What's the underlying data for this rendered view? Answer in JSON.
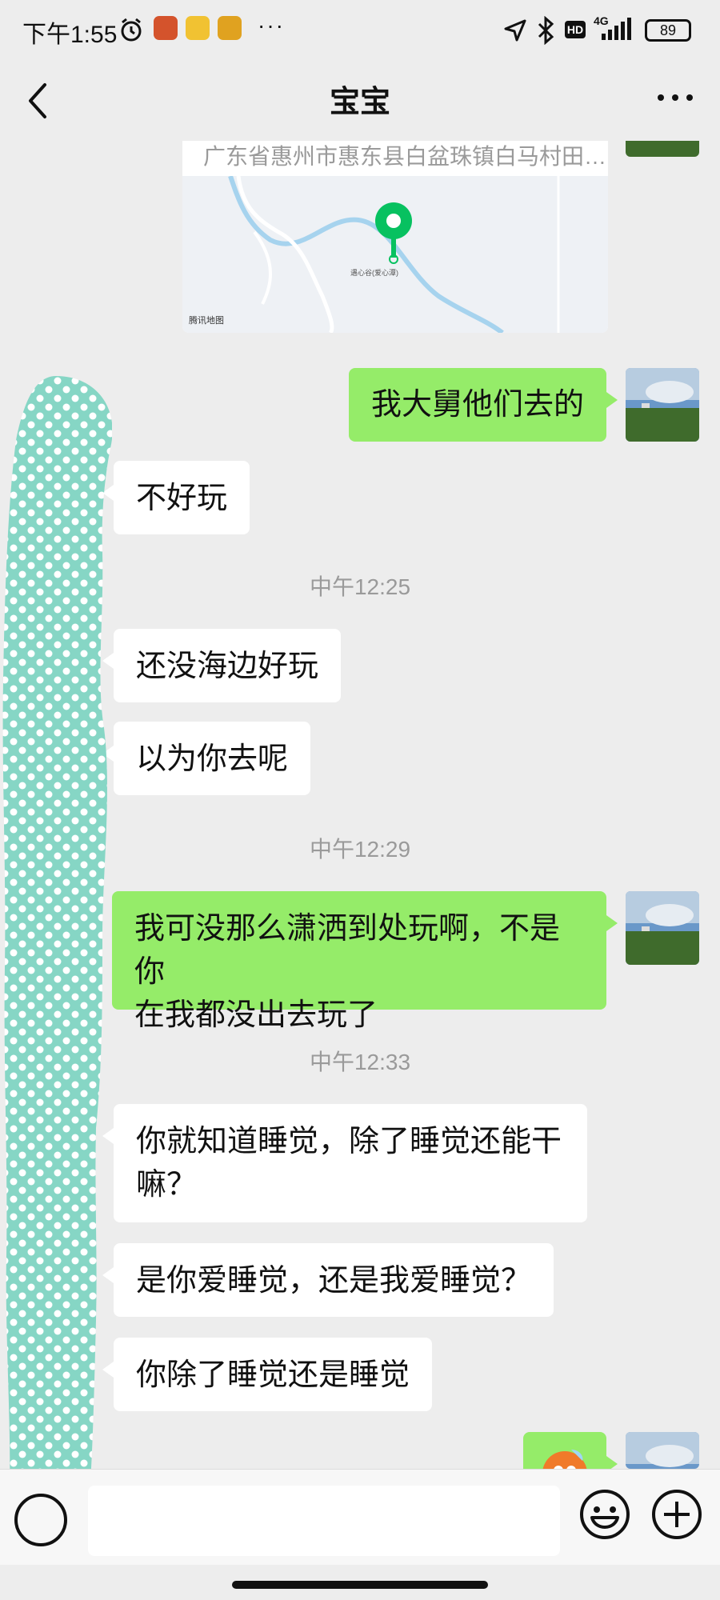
{
  "status_bar": {
    "time": "下午1:55",
    "network": "4G",
    "hd": "HD",
    "battery": "89"
  },
  "nav": {
    "title": "宝宝"
  },
  "location": {
    "address": "广东省惠州市惠东县白盆珠镇白马村田…",
    "pin_label": "遇心谷(爱心潭)",
    "map_brand": "腾讯地图"
  },
  "messages": [
    {
      "side": "right",
      "text": "我大舅他们去的"
    },
    {
      "side": "left",
      "text": "不好玩"
    },
    {
      "type": "time",
      "text": "中午12:25"
    },
    {
      "side": "left",
      "text": "还没海边好玩"
    },
    {
      "side": "left",
      "text": "以为你去呢"
    },
    {
      "type": "time",
      "text": "中午12:29"
    },
    {
      "side": "right",
      "text_line1": "我可没那么潇洒到处玩啊，不是你",
      "text_line2": "在我都没出去玩了"
    },
    {
      "type": "time",
      "text": "中午12:33"
    },
    {
      "side": "left",
      "text_line1": "你就知道睡觉，除了睡觉还能干",
      "text_line2": "嘛？"
    },
    {
      "side": "left",
      "text": "是你爱睡觉，还是我爱睡觉？"
    },
    {
      "side": "left",
      "text": "你除了睡觉还是睡觉"
    }
  ],
  "colors": {
    "background": "#ededed",
    "bubble_self": "#95ec69",
    "bubble_other": "#ffffff",
    "pin": "#07c160",
    "scribble": "#86d6c5"
  }
}
